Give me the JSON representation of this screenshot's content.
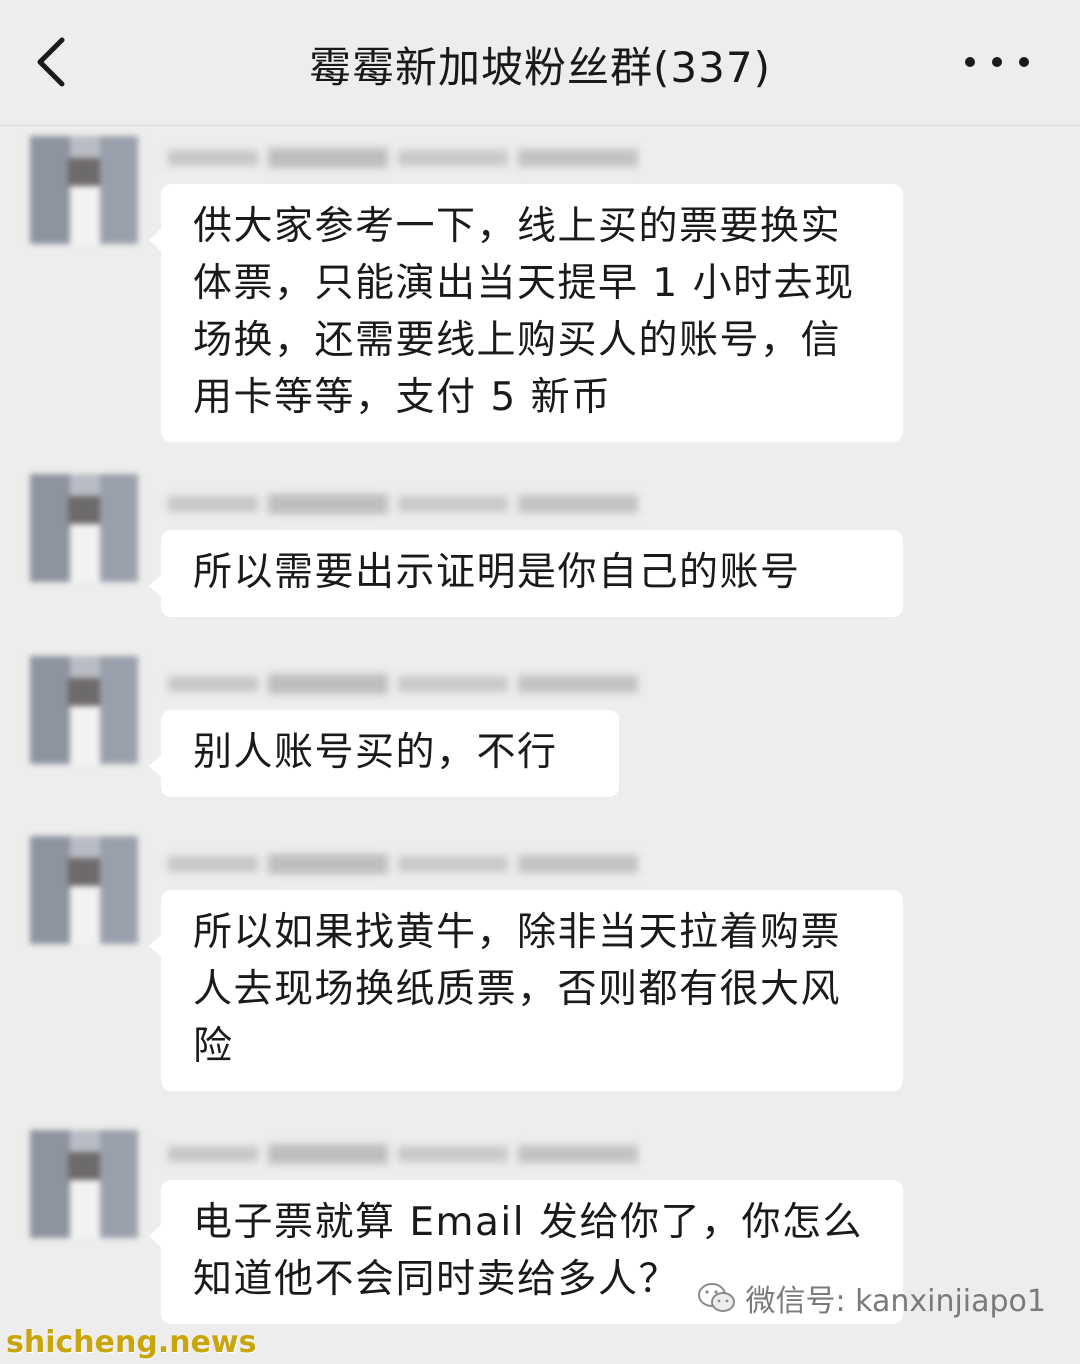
{
  "header": {
    "title": "霉霉新加坡粉丝群(337)",
    "back_icon": "chevron-left-icon",
    "more_icon": "more-dots-icon"
  },
  "messages": [
    {
      "text": "供大家参考一下，线上买的票要换实体票，只能演出当天提早 1 小时去现场换，还需要线上购买人的账号，信用卡等等，支付 5 新币"
    },
    {
      "text": "所以需要出示证明是你自己的账号"
    },
    {
      "text": "别人账号买的，不行"
    },
    {
      "text": "所以如果找黄牛，除非当天拉着购票人去现场换纸质票，否则都有很大风险"
    },
    {
      "text": "电子票就算 Email 发给你了，你怎么知道他不会同时卖给多人？"
    }
  ],
  "watermark": {
    "wechat_text": "微信号: kanxinjiapo1",
    "site_text": "shicheng.news"
  },
  "colors": {
    "background": "#ededed",
    "bubble": "#ffffff",
    "text": "#1a1a1a",
    "site_watermark": "#c9a40a"
  }
}
